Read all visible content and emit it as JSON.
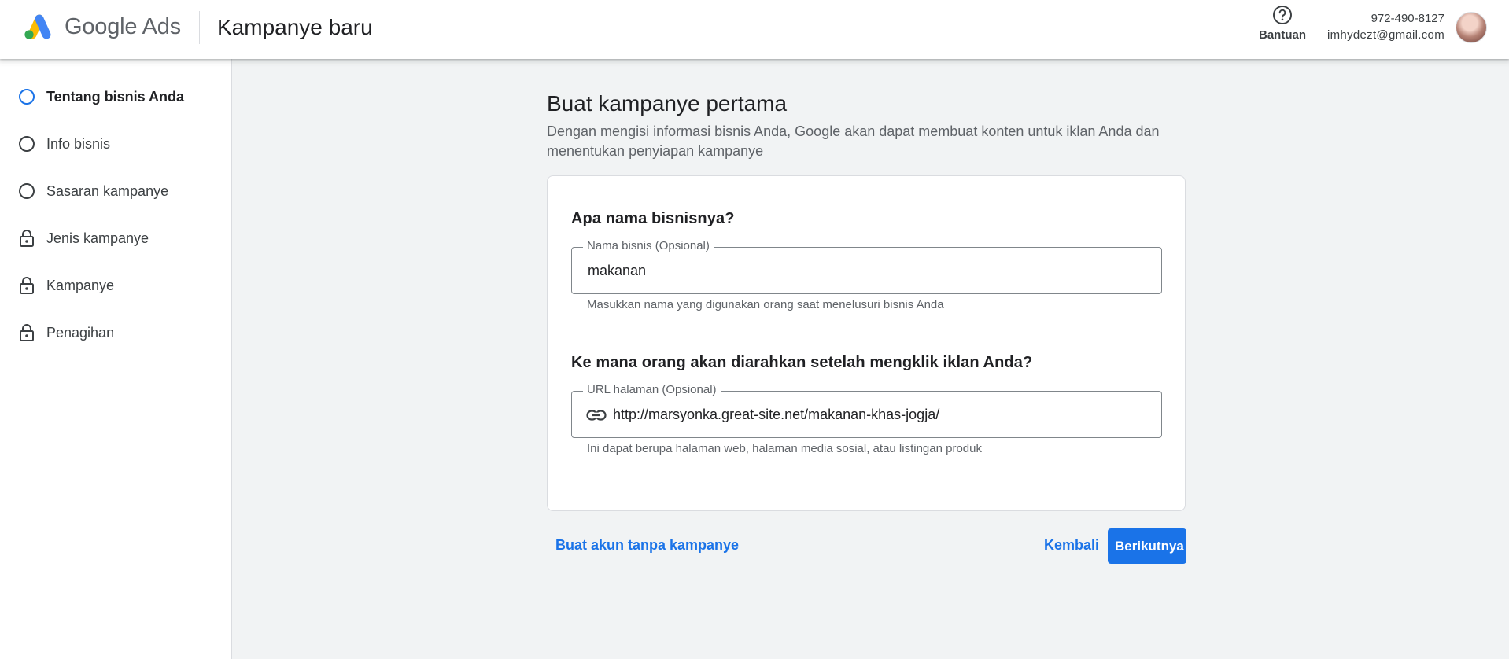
{
  "header": {
    "brand_google": "Google",
    "brand_ads": "Ads",
    "title": "Kampanye baru",
    "help_label": "Bantuan",
    "account_phone": "972-490-8127",
    "account_email": "imhydezt@gmail.com"
  },
  "sidebar": {
    "steps": [
      {
        "label": "Tentang bisnis Anda",
        "icon": "circle-outline-icon",
        "state": "active"
      },
      {
        "label": "Info bisnis",
        "icon": "circle-outline-icon",
        "state": "pending"
      },
      {
        "label": "Sasaran kampanye",
        "icon": "circle-outline-icon",
        "state": "pending"
      },
      {
        "label": "Jenis kampanye",
        "icon": "lock-icon",
        "state": "locked"
      },
      {
        "label": "Kampanye",
        "icon": "lock-icon",
        "state": "locked"
      },
      {
        "label": "Penagihan",
        "icon": "lock-icon",
        "state": "locked"
      }
    ]
  },
  "main": {
    "title": "Buat kampanye pertama",
    "description": "Dengan mengisi informasi bisnis Anda, Google akan dapat membuat konten untuk iklan Anda dan menentukan penyiapan kampanye",
    "business": {
      "question": "Apa nama bisnisnya?",
      "field_label": "Nama bisnis (Opsional)",
      "value": "makanan",
      "hint": "Masukkan nama yang digunakan orang saat menelusuri bisnis Anda"
    },
    "url": {
      "question": "Ke mana orang akan diarahkan setelah mengklik iklan Anda?",
      "field_label": "URL halaman (Opsional)",
      "value": "http://marsyonka.great-site.net/makanan-khas-jogja/",
      "hint": "Ini dapat berupa halaman web, halaman media sosial, atau listingan produk"
    }
  },
  "actions": {
    "no_campaign": "Buat akun tanpa kampanye",
    "back": "Kembali",
    "next": "Berikutnya"
  },
  "colors": {
    "accent": "#1a73e8",
    "background": "#f1f3f4",
    "logo_blue": "#4285f4",
    "logo_yellow": "#fbbc04",
    "logo_green": "#34a853"
  }
}
